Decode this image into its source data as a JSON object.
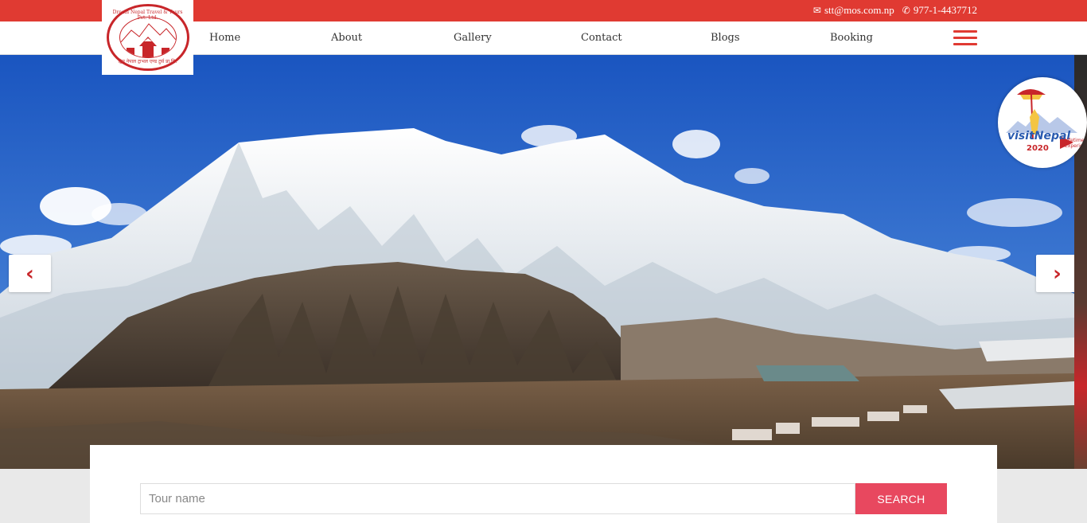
{
  "topbar": {
    "email": "stt@mos.com.np",
    "phone": "977-1-4437712",
    "email_icon": "envelope-icon",
    "phone_icon": "phone-icon",
    "color": "#e03a32"
  },
  "logo": {
    "text_top": "Dream Nepal Travel & Tours Pvt. Ltd.",
    "text_bottom": "ड्रिम नेपाल ट्राभल एण्ड टुर्स प्रा.लि."
  },
  "nav": {
    "items": [
      "Home",
      "About",
      "Gallery",
      "Contact",
      "Blogs",
      "Booking"
    ],
    "menu_icon": "hamburger-menu-icon"
  },
  "hero": {
    "prev_icon": "chevron-left-icon",
    "next_icon": "chevron-right-icon"
  },
  "badge": {
    "line1": "visitNepal",
    "year": "2020",
    "tagline": "Lifetime Experiences"
  },
  "search": {
    "placeholder": "Tour name",
    "button_label": "SEARCH",
    "button_color": "#e8485f"
  }
}
